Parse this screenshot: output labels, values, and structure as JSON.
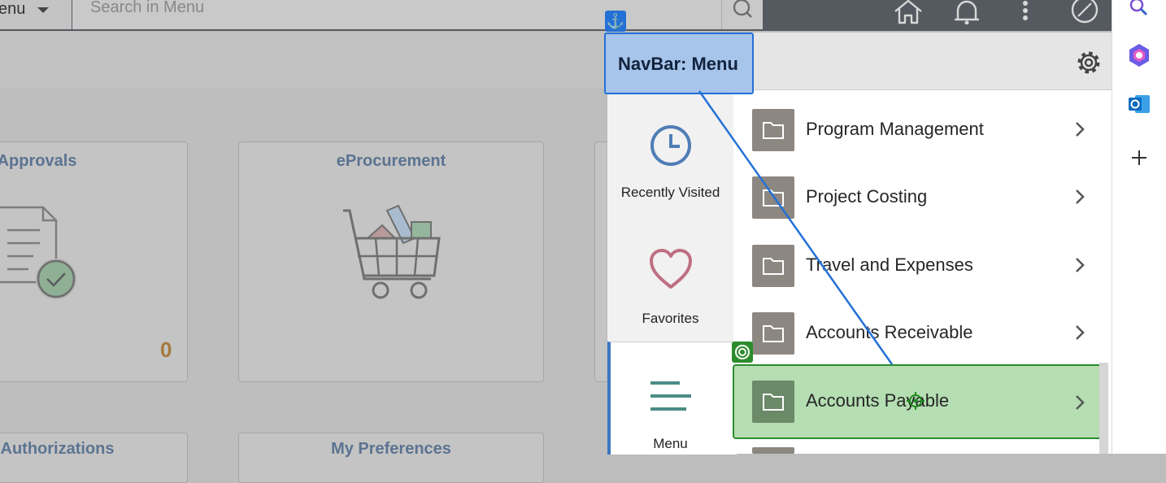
{
  "header": {
    "menu_label": "enu",
    "search_placeholder": "Search in Menu"
  },
  "tiles": [
    {
      "title": "Approvals",
      "count": "0"
    },
    {
      "title": "eProcurement"
    },
    {
      "title": "Authorizations"
    },
    {
      "title": "My Preferences"
    }
  ],
  "navbar": {
    "options": [
      {
        "label": "Recently Visited",
        "icon": "clock-icon"
      },
      {
        "label": "Favorites",
        "icon": "heart-icon"
      },
      {
        "label": "Menu",
        "icon": "menu-lines-icon"
      }
    ],
    "menu_items": [
      {
        "label": "Program Management"
      },
      {
        "label": "Project Costing"
      },
      {
        "label": "Travel and Expenses"
      },
      {
        "label": "Accounts Receivable"
      },
      {
        "label": "Accounts Payable",
        "highlighted": true
      }
    ]
  },
  "annotation": {
    "label": "NavBar: Menu"
  },
  "colors": {
    "header": "#555a60",
    "tile_title": "#5c7391",
    "count": "#a57a3f",
    "annotation_blue": "#2371d6",
    "highlight_green": "#2c8c2c",
    "folder_icon": "#8c8781"
  }
}
